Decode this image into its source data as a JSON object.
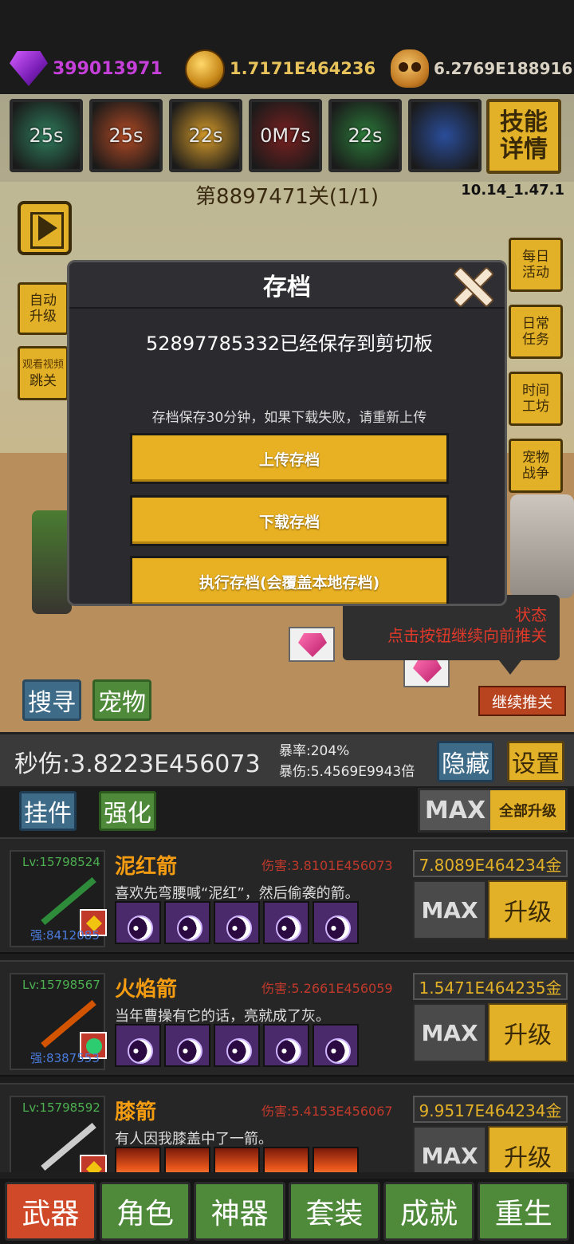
{
  "currency": {
    "gems": "399013971",
    "gold": "1.7171E464236",
    "souls": "6.2769E188916"
  },
  "skills": [
    {
      "label": "25s",
      "color": "#2e7d5c"
    },
    {
      "label": "25s",
      "color": "#b24a24"
    },
    {
      "label": "22s",
      "color": "#d69b2a"
    },
    {
      "label": "0M7s",
      "color": "#7a2020"
    },
    {
      "label": "22s",
      "color": "#2b7a3a"
    },
    {
      "label": "",
      "color": "#2a4d9a"
    }
  ],
  "skill_detail_label": "技能详情",
  "stage": {
    "title": "第8897471关(1/1)",
    "version": "10.14_1.47.1"
  },
  "left_buttons": {
    "auto_upgrade": "自动升级",
    "watch_video": "观看视频",
    "skip_stage": "跳关"
  },
  "right_buttons": [
    "每日活动",
    "日常任务",
    "时间工坊",
    "宠物战争"
  ],
  "scene_buttons": {
    "search": "搜寻",
    "pet": "宠物",
    "continue": "继续推关"
  },
  "tip_text": [
    "状态",
    "点击按钮继续向前推关"
  ],
  "modal": {
    "title": "存档",
    "saved_message": "52897785332已经保存到剪切板",
    "note": "存档保存30分钟，如果下载失败，请重新上传",
    "upload": "上传存档",
    "download": "下载存档",
    "execute": "执行存档(会覆盖本地存档)"
  },
  "stats": {
    "dps": "秒伤:3.8223E456073",
    "crit_rate": "暴率:204%",
    "crit_dmg": "暴伤:5.4569E9943倍",
    "hide": "隐藏",
    "settings": "设置"
  },
  "tabs": {
    "hang": "挂件",
    "strengthen": "强化",
    "max": "MAX",
    "upgrade_all": "全部升级"
  },
  "weapons": [
    {
      "level": "Lv:15798524",
      "strength": "强:8412085",
      "name": "泥红箭",
      "damage": "伤害:3.8101E456073",
      "desc": "喜欢先弯腰喊“泥红”，然后偷袭的箭。",
      "price": "7.8089E464234金",
      "max": "MAX",
      "upgrade": "升级",
      "arrow_color": "#2e8b3a",
      "rune_type": "yin"
    },
    {
      "level": "Lv:15798567",
      "strength": "强:8387553",
      "name": "火焰箭",
      "damage": "伤害:5.2661E456059",
      "desc": "当年曹操有它的话，亮就成了灰。",
      "price": "1.5471E464235金",
      "max": "MAX",
      "upgrade": "升级",
      "arrow_color": "#d35400",
      "rune_type": "yin"
    },
    {
      "level": "Lv:15798592",
      "strength": "",
      "name": "膝箭",
      "damage": "伤害:5.4153E456067",
      "desc": "有人因我膝盖中了一箭。",
      "price": "9.9517E464234金",
      "max": "MAX",
      "upgrade": "升级",
      "arrow_color": "#cccccc",
      "rune_type": "fire"
    }
  ],
  "bottom_nav": [
    {
      "label": "武器",
      "active": true
    },
    {
      "label": "角色",
      "active": false
    },
    {
      "label": "神器",
      "active": false
    },
    {
      "label": "套装",
      "active": false
    },
    {
      "label": "成就",
      "active": false
    },
    {
      "label": "重生",
      "active": false
    }
  ]
}
